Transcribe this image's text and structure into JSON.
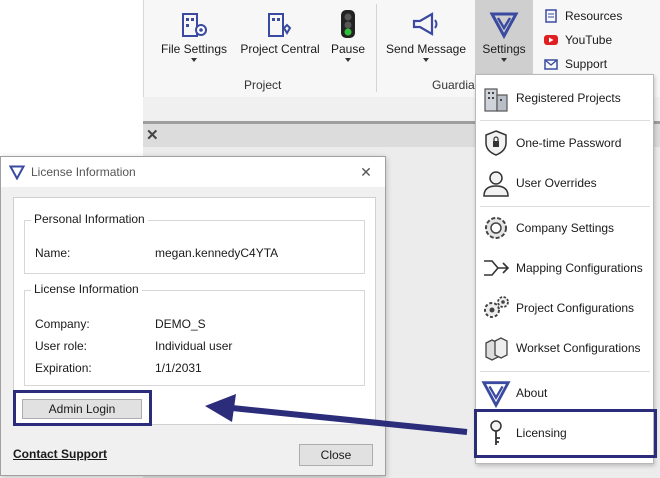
{
  "ribbon": {
    "file_settings": "File Settings",
    "project_central": "Project Central",
    "pause": "Pause",
    "send_message": "Send Message",
    "settings": "Settings",
    "group_project": "Project",
    "group_guardian": "Guardia",
    "links": {
      "resources": "Resources",
      "youtube": "YouTube",
      "support": "Support"
    }
  },
  "menu": {
    "items": [
      {
        "label": "Registered Projects",
        "icon": "building-icon"
      },
      {
        "label": "One-time Password",
        "icon": "shield-lock-icon"
      },
      {
        "label": "User Overrides",
        "icon": "user-icon"
      },
      {
        "label": "Company Settings",
        "icon": "gear-globe-icon"
      },
      {
        "label": "Mapping Configurations",
        "icon": "mapping-icon"
      },
      {
        "label": "Project Configurations",
        "icon": "gears-icon"
      },
      {
        "label": "Workset Configurations",
        "icon": "worksets-icon"
      },
      {
        "label": "About",
        "icon": "logo-icon"
      },
      {
        "label": "Licensing",
        "icon": "key-icon"
      }
    ]
  },
  "dialog": {
    "title": "License Information",
    "close_x": "✕",
    "personal": {
      "heading": "Personal Information",
      "name_label": "Name:",
      "name_value": "megan.kennedyC4YTA"
    },
    "license": {
      "heading": "License Information",
      "company_label": "Company:",
      "company_value": "DEMO_S",
      "role_label": "User role:",
      "role_value": "Individual user",
      "expiration_label": "Expiration:",
      "expiration_value": "1/1/2031"
    },
    "admin_login": "Admin Login",
    "contact_support": "Contact Support",
    "close": "Close"
  },
  "colors": {
    "highlight": "#2b2c7a",
    "brand": "#3a4aa0"
  }
}
